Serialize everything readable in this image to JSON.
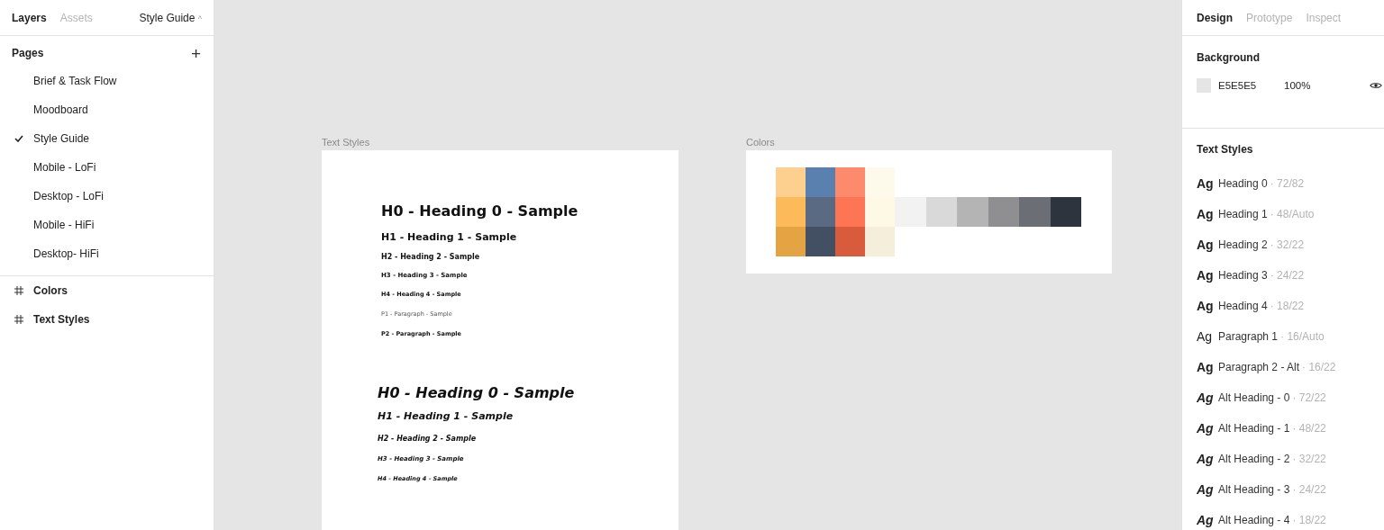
{
  "left_panel": {
    "tabs": [
      {
        "label": "Layers",
        "selected": true
      },
      {
        "label": "Assets",
        "selected": false
      }
    ],
    "page_menu": {
      "label": "Style Guide",
      "caret": "^"
    },
    "pages": {
      "title": "Pages",
      "add": "+",
      "items": [
        {
          "label": "Brief & Task Flow",
          "selected": false
        },
        {
          "label": "Moodboard",
          "selected": false
        },
        {
          "label": "Style Guide",
          "selected": true
        },
        {
          "label": "Mobile - LoFi",
          "selected": false
        },
        {
          "label": "Desktop - LoFi",
          "selected": false
        },
        {
          "label": "Mobile - HiFi",
          "selected": false
        },
        {
          "label": "Desktop- HiFi",
          "selected": false
        }
      ]
    },
    "layers": [
      {
        "label": "Colors"
      },
      {
        "label": "Text Styles"
      }
    ]
  },
  "canvas": {
    "text_frame": {
      "label": "Text Styles",
      "samples": [
        {
          "text": "H0 - Heading 0 - Sample",
          "kind": "h0",
          "italic": false
        },
        {
          "text": "H1 - Heading 1 - Sample",
          "kind": "h1",
          "italic": false
        },
        {
          "text": "H2 - Heading 2 - Sample",
          "kind": "h2",
          "italic": false
        },
        {
          "text": "H3 - Heading 3 - Sample",
          "kind": "h3",
          "italic": false
        },
        {
          "text": "H4 - Heading 4 - Sample",
          "kind": "h4",
          "italic": false
        },
        {
          "text": "P1 - Paragraph - Sample",
          "kind": "p1",
          "italic": false
        },
        {
          "text": "P2 - Paragraph - Sample",
          "kind": "p2",
          "italic": false
        },
        {
          "text": "H0 - Heading 0 - Sample",
          "kind": "h0",
          "italic": true
        },
        {
          "text": "H1 - Heading 1 - Sample",
          "kind": "h1",
          "italic": true
        },
        {
          "text": "H2 - Heading 2 - Sample",
          "kind": "h2",
          "italic": true
        },
        {
          "text": "H3 - Heading 3 - Sample",
          "kind": "h3",
          "italic": true
        },
        {
          "text": "H4 - Heading 4 - Sample",
          "kind": "h4",
          "italic": true
        }
      ]
    },
    "colors_frame": {
      "label": "Colors",
      "columns": [
        [
          {
            "color": "#fdd08f"
          },
          {
            "color": "#fdba5a"
          },
          {
            "color": "#e4a444"
          }
        ],
        [
          {
            "color": "#5a80b0"
          },
          {
            "color": "#5b6a83"
          },
          {
            "color": "#434f62"
          }
        ],
        [
          {
            "color": "#fd8a6c"
          },
          {
            "color": "#fd7554"
          },
          {
            "color": "#d95b3e"
          }
        ],
        [
          {
            "color": "#fdfaeb"
          },
          {
            "color": "#fef9e4"
          },
          {
            "color": "#f4eedb"
          }
        ]
      ],
      "grays": [
        {
          "color": "#f2f2f2"
        },
        {
          "color": "#d9d9d9"
        },
        {
          "color": "#b4b4b4"
        },
        {
          "color": "#8f8f91"
        },
        {
          "color": "#6c6e75"
        },
        {
          "color": "#2e343d"
        }
      ]
    }
  },
  "right_panel": {
    "tabs": [
      {
        "label": "Design",
        "selected": true
      },
      {
        "label": "Prototype",
        "selected": false
      },
      {
        "label": "Inspect",
        "selected": false
      }
    ],
    "background": {
      "title": "Background",
      "color": "#e5e5e5",
      "hex": "E5E5E5",
      "opacity": "100%"
    },
    "text_styles": {
      "title": "Text Styles",
      "items": [
        {
          "sample": "Ag",
          "kind": "bold",
          "name": "Heading 0",
          "meta": "· 72/82"
        },
        {
          "sample": "Ag",
          "kind": "bold",
          "name": "Heading 1",
          "meta": "· 48/Auto"
        },
        {
          "sample": "Ag",
          "kind": "bold",
          "name": "Heading 2",
          "meta": "· 32/22"
        },
        {
          "sample": "Ag",
          "kind": "bold",
          "name": "Heading 3",
          "meta": "· 24/22"
        },
        {
          "sample": "Ag",
          "kind": "bold",
          "name": "Heading 4",
          "meta": "· 18/22"
        },
        {
          "sample": "Ag",
          "kind": "regular",
          "name": "Paragraph 1",
          "meta": "· 16/Auto"
        },
        {
          "sample": "Ag",
          "kind": "bold",
          "name": "Paragraph 2 - Alt",
          "meta": "· 16/22"
        },
        {
          "sample": "Ag",
          "kind": "italic",
          "name": "Alt Heading - 0",
          "meta": "· 72/22"
        },
        {
          "sample": "Ag",
          "kind": "italic",
          "name": "Alt Heading - 1",
          "meta": "· 48/22"
        },
        {
          "sample": "Ag",
          "kind": "italic",
          "name": "Alt Heading - 2",
          "meta": "· 32/22"
        },
        {
          "sample": "Ag",
          "kind": "italic",
          "name": "Alt Heading - 3",
          "meta": "· 24/22"
        },
        {
          "sample": "Ag",
          "kind": "italic",
          "name": "Alt Heading - 4",
          "meta": "· 18/22"
        }
      ]
    }
  }
}
